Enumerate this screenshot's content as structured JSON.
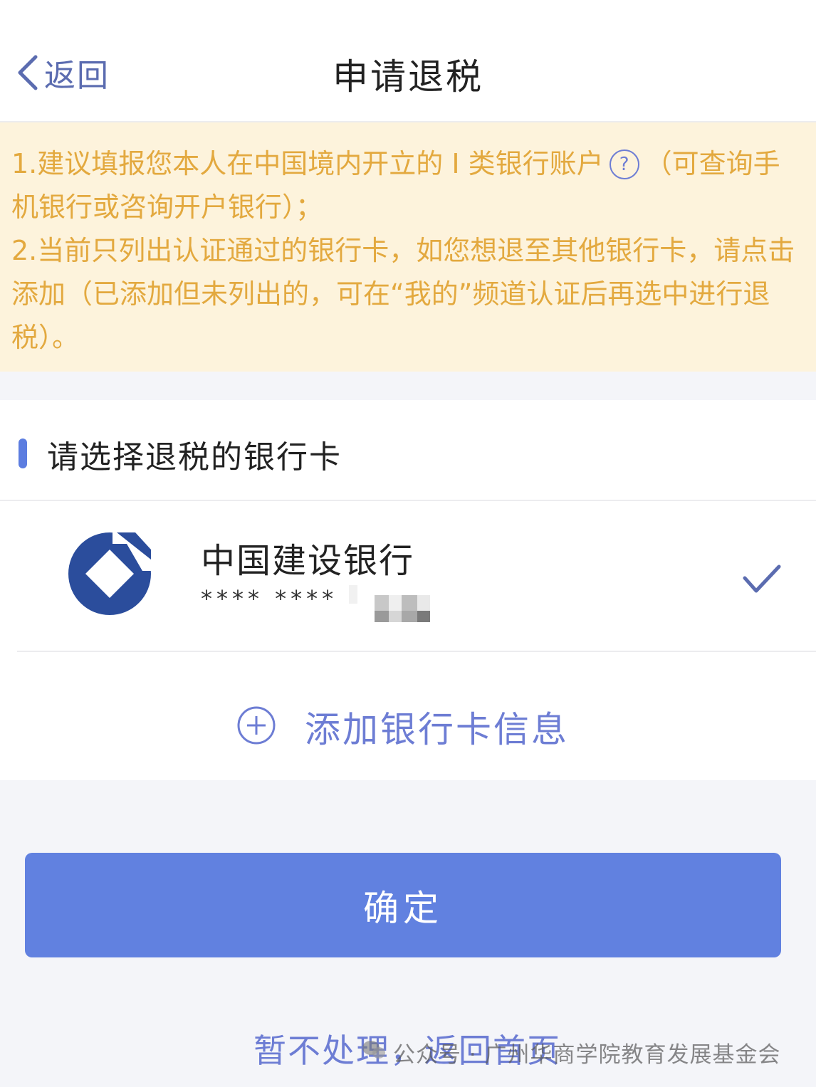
{
  "nav": {
    "back_label": "返回",
    "title": "申请退税"
  },
  "notice": {
    "line1_before_icon": "1.建议填报您本人在中国境内开立的 I 类银行账户",
    "help_icon": "question-circle",
    "line1_after_icon": "（可查询手机银行或咨询开户银行）；",
    "line2": "2.当前只列出认证通过的银行卡，如您想退至其他银行卡，请点击添加（已添加但未列出的，可在“我的”频道认证后再选中进行退税）。",
    "color": "#e3a93f",
    "background": "#fdf3dc"
  },
  "card_section": {
    "title": "请选择退税的银行卡",
    "cards": [
      {
        "bank_name": "中国建设银行",
        "card_number_masked": "**** ****",
        "logo_icon": "ccb-logo",
        "selected": true,
        "selected_icon": "checkmark"
      }
    ],
    "add_card_icon": "plus-circle",
    "add_card_label": "添加银行卡信息"
  },
  "actions": {
    "confirm_label": "确定",
    "later_label": "暂不处理，返回首页"
  },
  "watermark": {
    "icon": "wechat-official-account",
    "text": "公众号 · 广州华商学院教育发展基金会"
  },
  "colors": {
    "accent": "#6181e0",
    "link": "#6d7dd4",
    "bank_logo": "#2b4d9c"
  }
}
